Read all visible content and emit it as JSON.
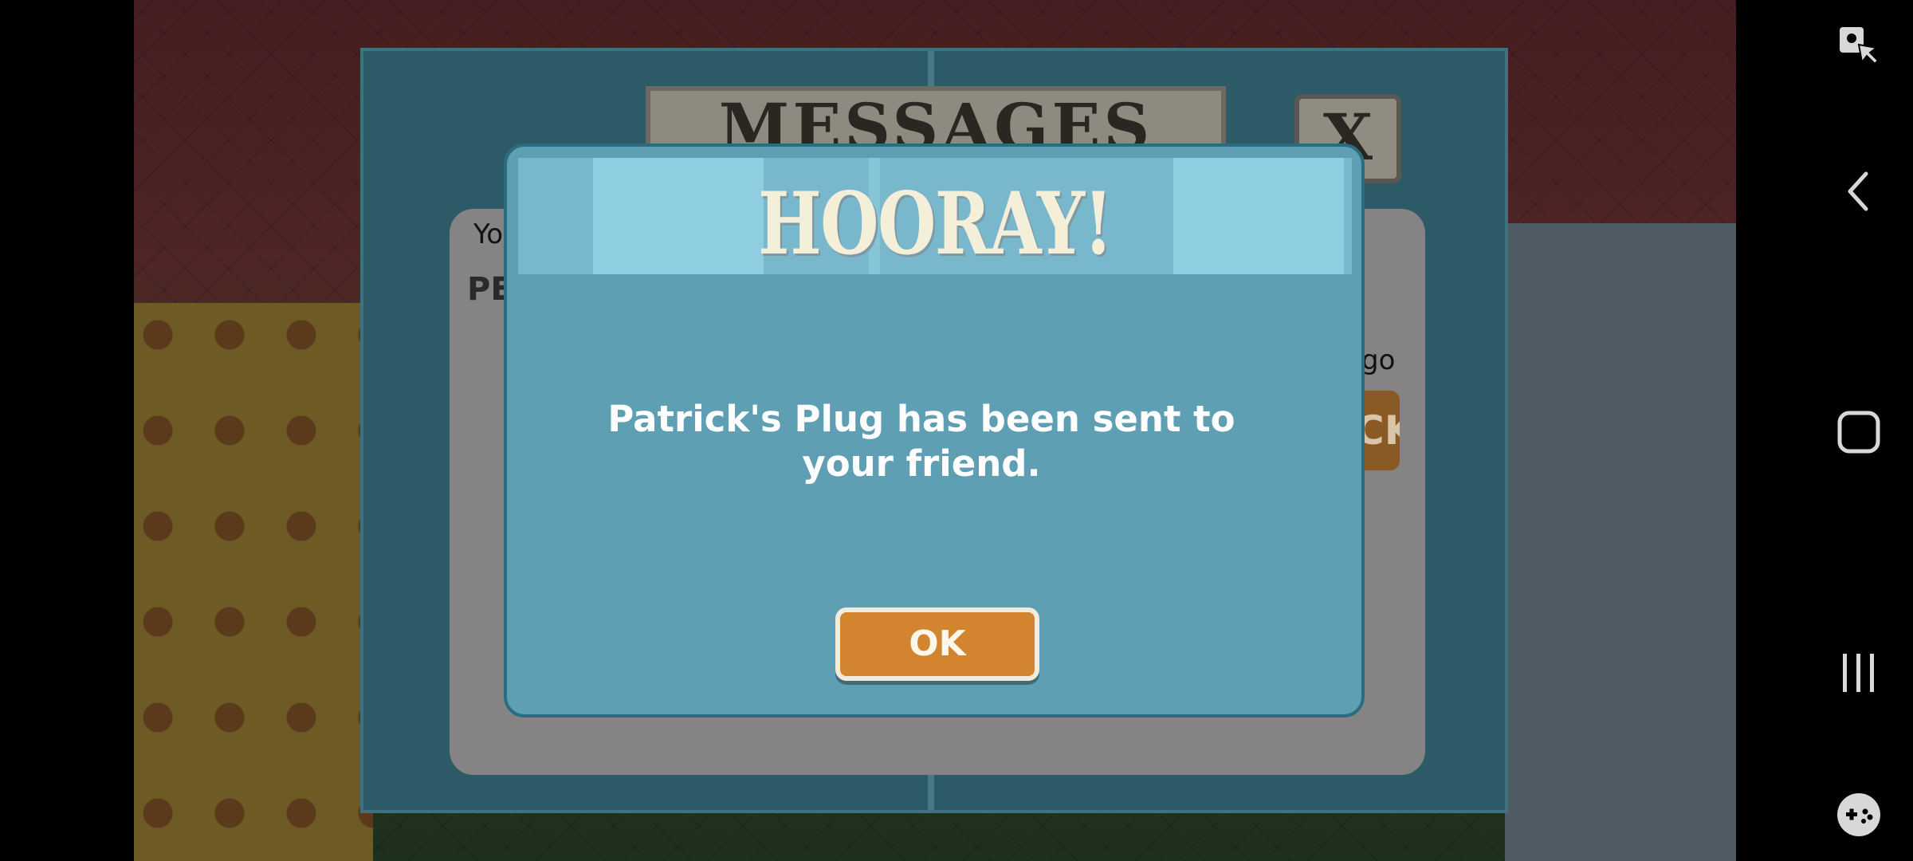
{
  "background_dialog": {
    "title": "MESSAGES",
    "close_label": "X",
    "snippet_you": "Yo",
    "snippet_pe": "PE",
    "snippet_ago": "go",
    "snippet_btn": "CK"
  },
  "modal": {
    "title": "HOORAY!",
    "message": "Patrick's Plug has been sent to your friend.",
    "ok_label": "OK"
  },
  "colors": {
    "modal_bg": "#5f9fb4",
    "ok_button": "#d2842e",
    "title_text": "#f4efd9"
  },
  "system_nav": {
    "icons": [
      "accessibility-icon",
      "back-icon",
      "home-icon",
      "recents-icon",
      "game-tools-icon"
    ]
  }
}
